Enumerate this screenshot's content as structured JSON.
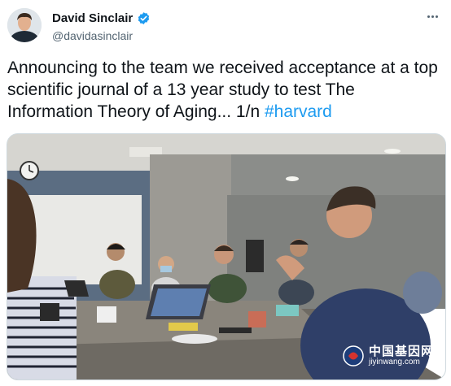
{
  "author": {
    "display_name": "David Sinclair",
    "handle": "@davidasinclair",
    "verified": true,
    "verified_color": "#1d9bf0"
  },
  "tweet": {
    "text": "Announcing to the team we received acceptance at a top scientific journal of a 13 year study to test The Information Theory of Aging... 1/n ",
    "hashtag": "#harvard",
    "hashtag_color": "#1d9bf0"
  },
  "media": {
    "icon": "team-meeting-photo"
  },
  "watermark": {
    "cn": "中国基因网",
    "url": "jiyinwang.com"
  },
  "icons": {
    "more": "more-options-icon",
    "verified": "verified-badge-icon"
  }
}
